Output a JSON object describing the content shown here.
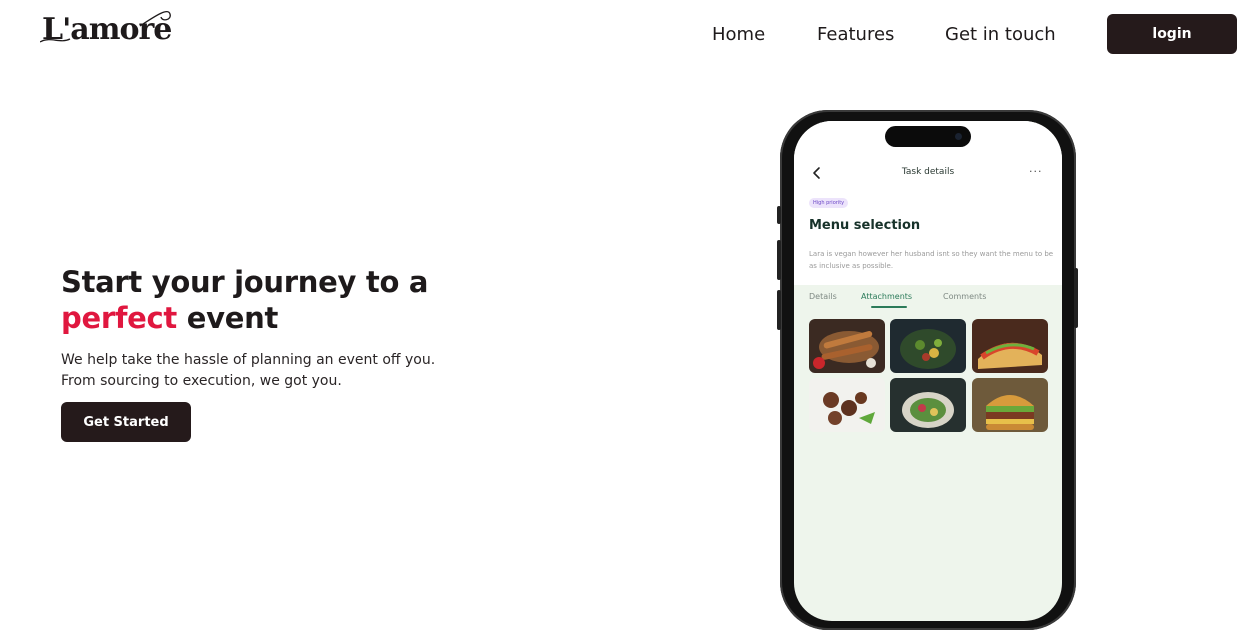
{
  "brand": {
    "name": "L'amore"
  },
  "nav": {
    "home": "Home",
    "features": "Features",
    "contact": "Get in touch",
    "login": "login"
  },
  "hero": {
    "title_line1": "Start your journey to a",
    "title_accent": "perfect",
    "title_rest": " event",
    "subtitle_line1": "We help take the hassle of planning an event off you.",
    "subtitle_line2": "From sourcing to execution, we got you.",
    "cta": "Get Started"
  },
  "phone": {
    "header_title": "Task details",
    "more": "···",
    "priority": "High priority",
    "task_title": "Menu selection",
    "task_description": "Lara is vegan however her husband isnt so they want the menu to be as inclusive as possible.",
    "tabs": [
      "Details",
      "Attachments",
      "Comments"
    ],
    "active_tab": "Attachments"
  },
  "colors": {
    "accent": "#e0173f",
    "dark_button": "#251a1b",
    "app_green": "#2c7b5a",
    "screen_bg": "#eef5ec"
  },
  "icons": {
    "back": "chevron-left-icon",
    "more": "more-horizontal-icon"
  }
}
